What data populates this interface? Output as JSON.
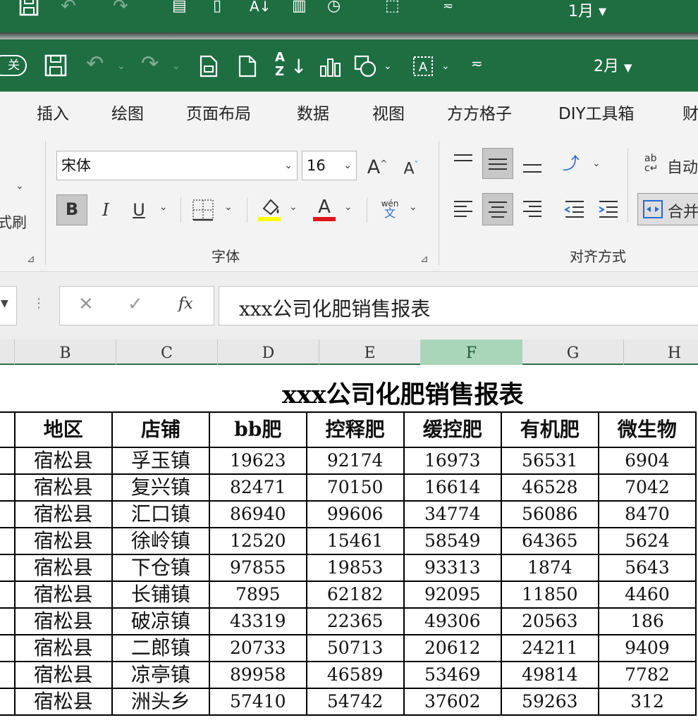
{
  "back_window": {
    "month": "1月"
  },
  "front_window": {
    "close_label": "关",
    "month": "2月"
  },
  "tabs": [
    "插入",
    "绘图",
    "页面布局",
    "数据",
    "视图",
    "方方格子",
    "DIY工具箱",
    "财"
  ],
  "ribbon": {
    "font_name": "宋体",
    "font_size": "16",
    "grow_font": "A",
    "shrink_font": "A",
    "bold": "B",
    "italic": "I",
    "underline": "U",
    "font_color_glyph": "A",
    "phonetic_top": "wén",
    "phonetic_bottom": "文",
    "wrap_text_label": "自动",
    "merge_label": "合并",
    "clipboard_partial": "式刷",
    "font_group_label": "字体",
    "align_group_label": "对齐方式",
    "fill_color": "#ffff00",
    "font_color": "#e0141b"
  },
  "formula_bar": {
    "fx": "fx",
    "content": "xxx公司化肥销售报表"
  },
  "columns": [
    "B",
    "C",
    "D",
    "E",
    "F",
    "G",
    "H"
  ],
  "active_column": "F",
  "sheet": {
    "title": "xxx公司化肥销售报表",
    "headers": [
      "地区",
      "店铺",
      "bb肥",
      "控释肥",
      "缓控肥",
      "有机肥",
      "微生物"
    ],
    "rows": [
      [
        "宿松县",
        "孚玉镇",
        "19623",
        "92174",
        "16973",
        "56531",
        "6904"
      ],
      [
        "宿松县",
        "复兴镇",
        "82471",
        "70150",
        "16614",
        "46528",
        "7042"
      ],
      [
        "宿松县",
        "汇口镇",
        "86940",
        "99606",
        "34774",
        "56086",
        "8470"
      ],
      [
        "宿松县",
        "徐岭镇",
        "12520",
        "15461",
        "58549",
        "64365",
        "5624"
      ],
      [
        "宿松县",
        "下仓镇",
        "97855",
        "19853",
        "93313",
        "1874",
        "5643"
      ],
      [
        "宿松县",
        "长铺镇",
        "7895",
        "62182",
        "92095",
        "11850",
        "4460"
      ],
      [
        "宿松县",
        "破凉镇",
        "43319",
        "22365",
        "49306",
        "20563",
        "186"
      ],
      [
        "宿松县",
        "二郎镇",
        "20733",
        "50713",
        "20612",
        "24211",
        "9409"
      ],
      [
        "宿松县",
        "凉亭镇",
        "89958",
        "46589",
        "53469",
        "49814",
        "7782"
      ],
      [
        "宿松县",
        "洲头乡",
        "57410",
        "54742",
        "37602",
        "59263",
        "312"
      ]
    ]
  }
}
